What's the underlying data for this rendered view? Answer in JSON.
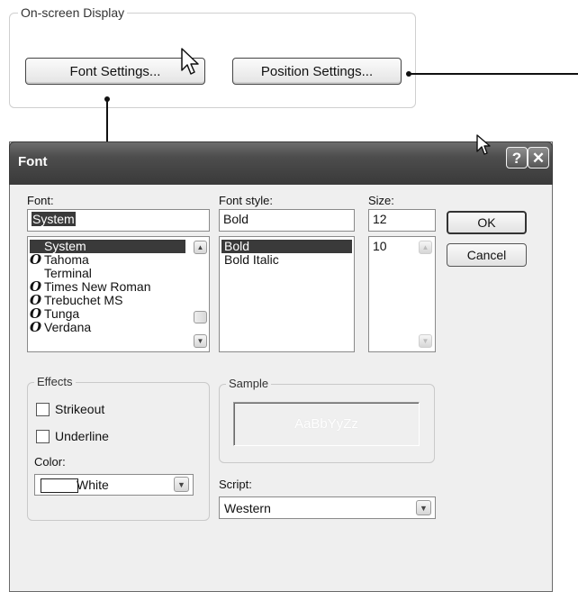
{
  "osd": {
    "group_title": "On-screen Display",
    "font_settings_label": "Font Settings...",
    "position_settings_label": "Position Settings..."
  },
  "dialog": {
    "title": "Font",
    "help_glyph": "?",
    "close_glyph": "✕",
    "font_label": "Font:",
    "font_value": "System",
    "font_list": [
      {
        "name": "System",
        "truetype": false,
        "selected": true
      },
      {
        "name": "Tahoma",
        "truetype": true,
        "selected": false
      },
      {
        "name": "Terminal",
        "truetype": false,
        "selected": false
      },
      {
        "name": "Times New Roman",
        "truetype": true,
        "selected": false
      },
      {
        "name": "Trebuchet MS",
        "truetype": true,
        "selected": false
      },
      {
        "name": "Tunga",
        "truetype": true,
        "selected": false
      },
      {
        "name": "Verdana",
        "truetype": true,
        "selected": false
      }
    ],
    "truetype_glyph": "O",
    "style_label": "Font style:",
    "style_value": "Bold",
    "style_list": [
      {
        "name": "Bold",
        "selected": true
      },
      {
        "name": "Bold Italic",
        "selected": false
      }
    ],
    "size_label": "Size:",
    "size_value": "12",
    "size_list": [
      "10"
    ],
    "ok_label": "OK",
    "cancel_label": "Cancel",
    "effects_label": "Effects",
    "strikeout_label": "Strikeout",
    "strikeout_checked": false,
    "underline_label": "Underline",
    "underline_checked": false,
    "color_label": "Color:",
    "color_value": "White",
    "color_swatch": "#ffffff",
    "sample_label": "Sample",
    "sample_text": "AaBbYyZz",
    "script_label": "Script:",
    "script_value": "Western"
  },
  "colors": {
    "selection": "#3a3a3a",
    "title_bar": "#4d4d4d",
    "dialog_bg": "#efefef"
  }
}
